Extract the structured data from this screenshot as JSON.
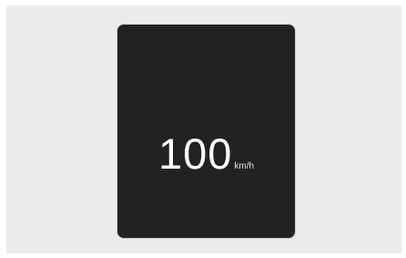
{
  "screen": {
    "background_color": "#ebebeb",
    "display_color": "#222222",
    "text_color": "#ffffff"
  },
  "speedometer": {
    "value": "100",
    "unit": "km/h"
  }
}
